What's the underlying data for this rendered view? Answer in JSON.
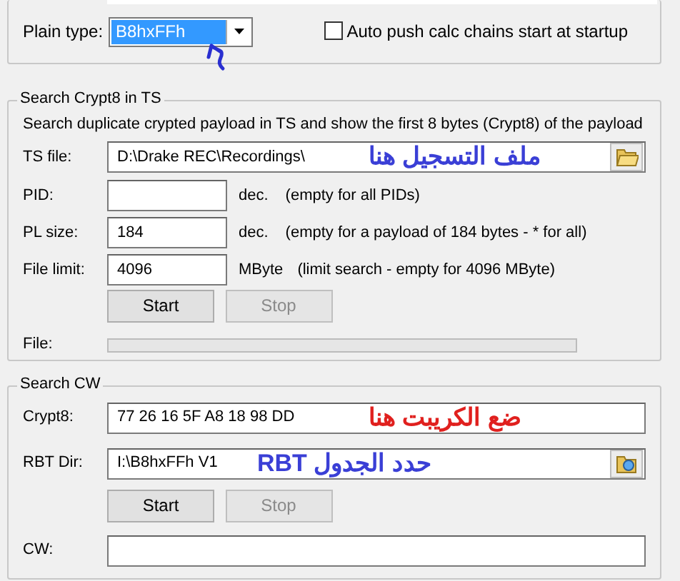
{
  "plain_panel": {
    "plain_type": {
      "label": "Plain type:",
      "value": "B8hxFFh"
    },
    "auto_push": {
      "label": "Auto push calc chains start at startup",
      "checked": false
    }
  },
  "search_crypt8": {
    "title": "Search Crypt8 in TS",
    "description": "Search duplicate crypted payload in TS and show the first 8 bytes (Crypt8) of the payload",
    "rows": [
      {
        "kind": "path",
        "label": "TS file:",
        "value": "D:\\Drake REC\\Recordings\\",
        "annotation": {
          "text": "ملف التسجيل هنا",
          "color": "#3a3fd6"
        }
      },
      {
        "kind": "number",
        "label": "PID:",
        "unit": "dec.",
        "hint": "(empty for all PIDs)"
      },
      {
        "kind": "number",
        "label": "PL size:",
        "value": "184",
        "unit": "dec.",
        "hint": "(empty for a payload of 184 bytes - * for all)"
      },
      {
        "kind": "number",
        "label": "File limit:",
        "value": "4096",
        "unit": "MByte",
        "hint": "(limit search - empty for 4096 MByte)"
      }
    ],
    "buttons": [
      {
        "label": "Start",
        "disabled": false
      },
      {
        "label": "Stop",
        "disabled": true
      }
    ],
    "file": {
      "label": "File:",
      "level": 0
    }
  },
  "search_cw": {
    "title": "Search CW",
    "rows": [
      {
        "kind": "text",
        "label": "Crypt8:",
        "value": "77 26 16 5F A8 18 98 DD",
        "annotation": {
          "text": "ضع الكريبت هنا",
          "color": "#e0201e"
        }
      },
      {
        "kind": "path",
        "label": "RBT Dir:",
        "value": "I:\\B8hxFFh V1",
        "annotation": {
          "text": "حدد الجدول RBT",
          "color": "#3a3fd6"
        }
      }
    ],
    "buttons": [
      {
        "label": "Start",
        "disabled": false
      },
      {
        "label": "Stop",
        "disabled": true
      }
    ],
    "cw": {
      "label": "CW:"
    }
  }
}
